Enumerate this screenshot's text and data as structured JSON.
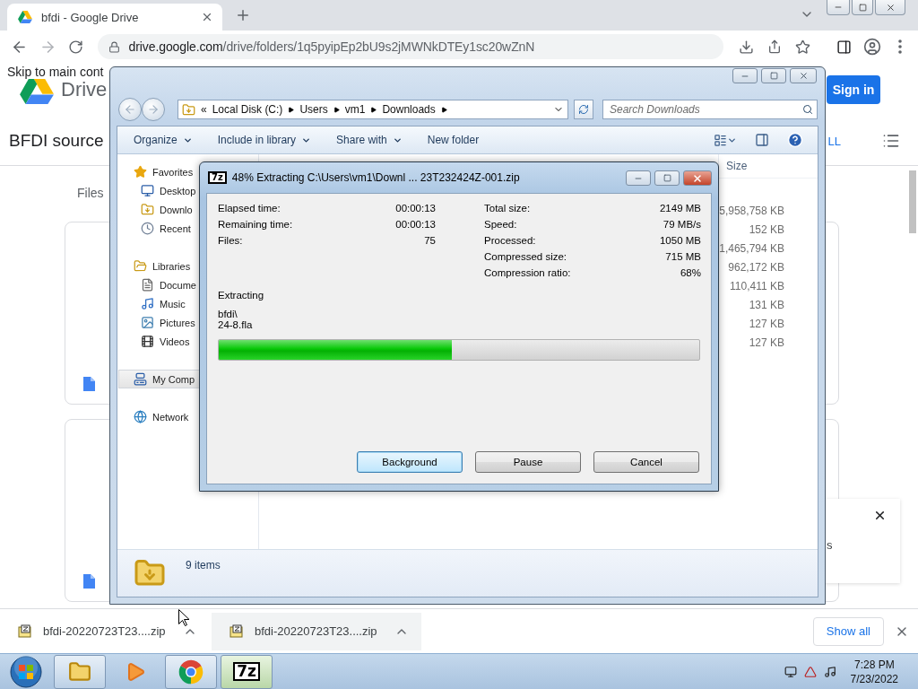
{
  "browser": {
    "tabs": [
      {
        "title": "bfdi - Google Drive",
        "selected": true
      }
    ],
    "address": {
      "host": "drive.google.com",
      "path": "/drive/folders/1q5pyipEp2bU9s2jMWNkDTEy1sc20wZnN"
    }
  },
  "drive": {
    "skip_link": "Skip to main cont",
    "product": "Drive",
    "sign_in": "Sign in",
    "folder_title": "BFDI source",
    "header_link": "LL",
    "section_label": "Files",
    "cards": [
      {
        "kind": "document"
      },
      {
        "kind": "document"
      }
    ],
    "toast": {
      "text": "s"
    }
  },
  "explorer": {
    "breadcrumb_prefix": "«",
    "breadcrumb": [
      "Local Disk (C:)",
      "Users",
      "vm1",
      "Downloads"
    ],
    "search": {
      "placeholder": "Search Downloads"
    },
    "toolbar": [
      {
        "label": "Organize",
        "menu": true
      },
      {
        "label": "Include in library",
        "menu": true
      },
      {
        "label": "Share with",
        "menu": true
      },
      {
        "label": "New folder",
        "menu": false
      }
    ],
    "nav": [
      {
        "label": "Favorites",
        "kind": "star",
        "selected": false,
        "children": [
          {
            "label": "Desktop",
            "kind": "desktop",
            "selected": false
          },
          {
            "label": "Downlo",
            "kind": "downloads",
            "selected": false
          },
          {
            "label": "Recent",
            "kind": "recent",
            "selected": false
          }
        ]
      },
      {
        "label": "Libraries",
        "kind": "library",
        "selected": false,
        "children": [
          {
            "label": "Docume",
            "kind": "document",
            "selected": false
          },
          {
            "label": "Music",
            "kind": "music",
            "selected": false
          },
          {
            "label": "Pictures",
            "kind": "picture",
            "selected": false
          },
          {
            "label": "Videos",
            "kind": "video",
            "selected": false
          }
        ]
      },
      {
        "label": "My Comp",
        "kind": "computer",
        "selected": true
      },
      {
        "label": "Network",
        "kind": "network",
        "selected": false
      }
    ],
    "columns": [
      "Size"
    ],
    "rows": [
      {
        "size": "5,958,758 KB"
      },
      {
        "size": "152 KB"
      },
      {
        "size": "1,465,794 KB"
      },
      {
        "size": "962,172 KB"
      },
      {
        "size": "110,411 KB"
      },
      {
        "size": "131 KB"
      },
      {
        "size": "127 KB"
      },
      {
        "size": "127 KB"
      }
    ],
    "status": "9 items"
  },
  "dialog": {
    "icon_label": "7z",
    "title": "48% Extracting C:\\Users\\vm1\\Downl ... 23T232424Z-001.zip",
    "stats_left": [
      {
        "label": "Elapsed time:",
        "value": "00:00:13"
      },
      {
        "label": "Remaining time:",
        "value": "00:00:13"
      },
      {
        "label": "Files:",
        "value": "75"
      }
    ],
    "stats_right": [
      {
        "label": "Total size:",
        "value": "2149 MB"
      },
      {
        "label": "Speed:",
        "value": "79 MB/s"
      },
      {
        "label": "Processed:",
        "value": "1050 MB"
      },
      {
        "label": "Compressed size:",
        "value": "715 MB"
      },
      {
        "label": "Compression ratio:",
        "value": "68%"
      }
    ],
    "status": "Extracting",
    "current_path": [
      "bfdi\\",
      "24-8.fla"
    ],
    "progress": {
      "level": 0.485
    },
    "buttons": [
      {
        "label": "Background",
        "focused": true
      },
      {
        "label": "Pause",
        "focused": false
      },
      {
        "label": "Cancel",
        "focused": false
      }
    ]
  },
  "downloads": {
    "items": [
      {
        "name": "bfdi-20220723T23....zip",
        "highlighted": false
      },
      {
        "name": "bfdi-20220723T23....zip",
        "highlighted": true
      }
    ],
    "show_all": "Show all"
  },
  "taskbar": {
    "apps": [
      {
        "kind": "explorer",
        "open": true,
        "focused": false
      },
      {
        "kind": "media",
        "open": false,
        "focused": false
      },
      {
        "kind": "chrome",
        "open": true,
        "focused": false
      },
      {
        "kind": "sevenzip",
        "label": "7z",
        "open": true,
        "focused": true
      }
    ],
    "time": "7:28 PM",
    "date": "7/23/2022"
  }
}
